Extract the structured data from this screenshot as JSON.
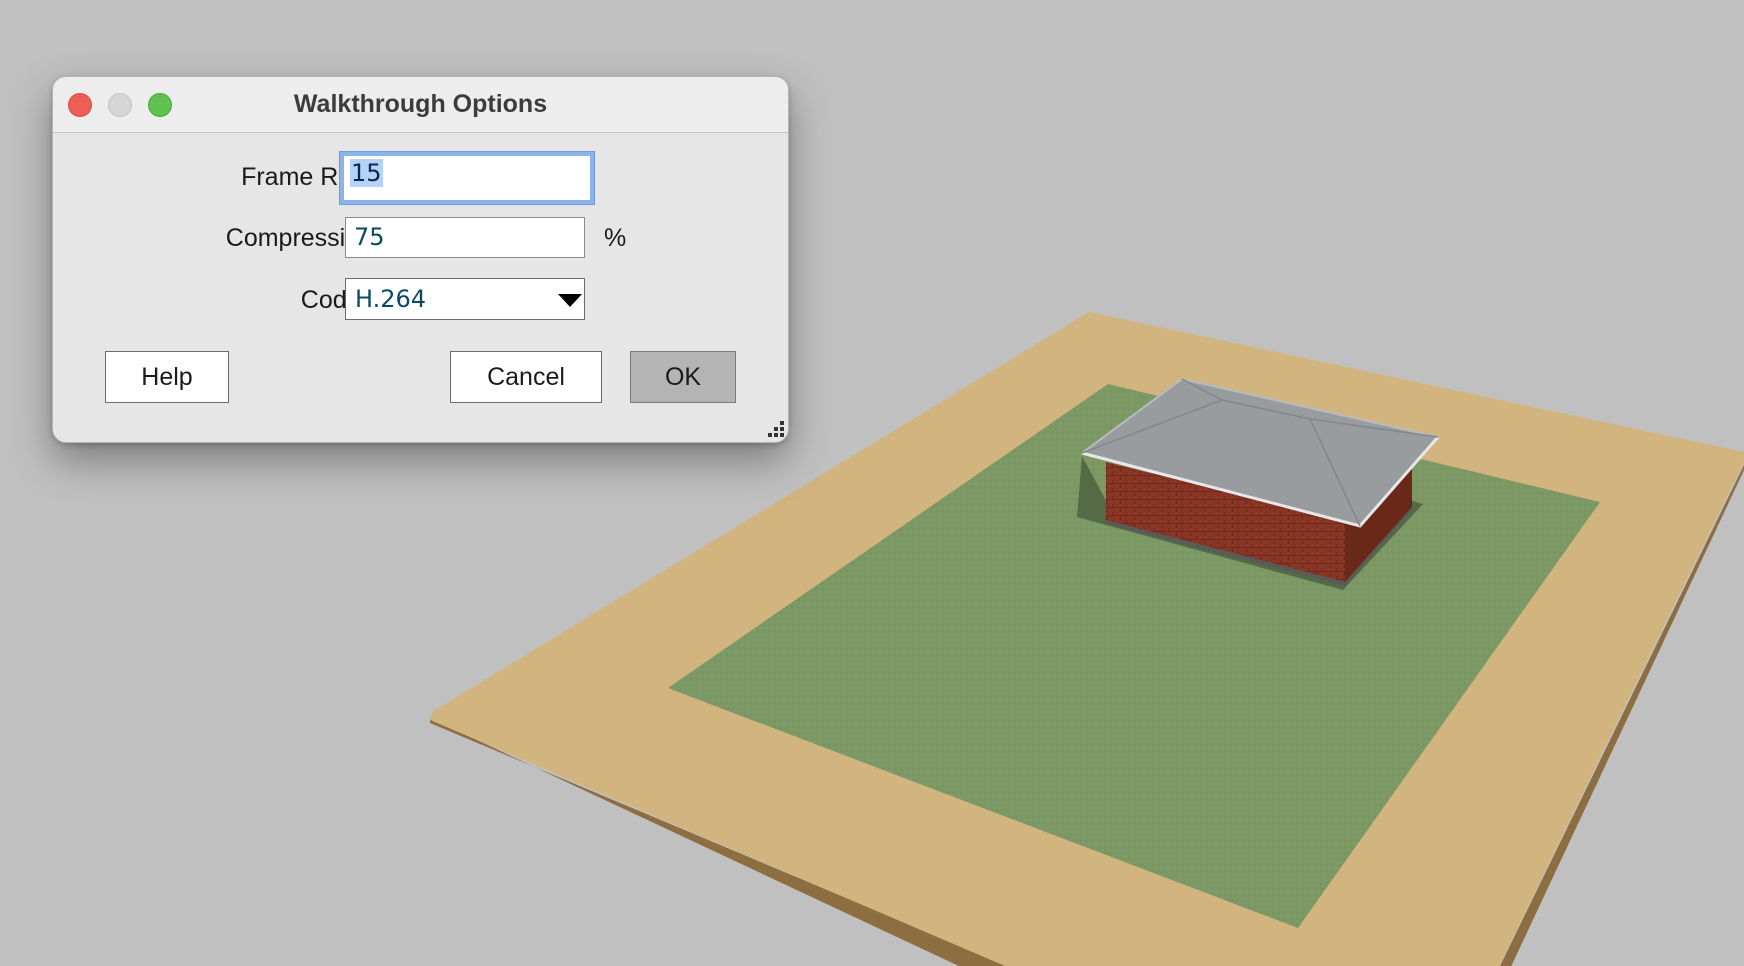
{
  "dialog": {
    "title": "Walkthrough Options",
    "window_controls": [
      "close-icon",
      "minimize-icon",
      "zoom-icon"
    ],
    "fields": {
      "frame_rate": {
        "label": "Frame Rate:",
        "value": "15"
      },
      "compression": {
        "label": "Compression:",
        "value": "75",
        "unit": "%"
      },
      "codec": {
        "label": "Codec:",
        "value": "H.264"
      }
    },
    "buttons": {
      "help": "Help",
      "cancel": "Cancel",
      "ok": "OK"
    }
  },
  "scene": {
    "description_icons": [
      "terrain-plot",
      "house-model"
    ],
    "colors": {
      "background": "#c0c0c0",
      "sand": "#d2b47e",
      "grass": "#7c9864",
      "brick": "#8a3524",
      "roof": "#989c9e"
    }
  }
}
